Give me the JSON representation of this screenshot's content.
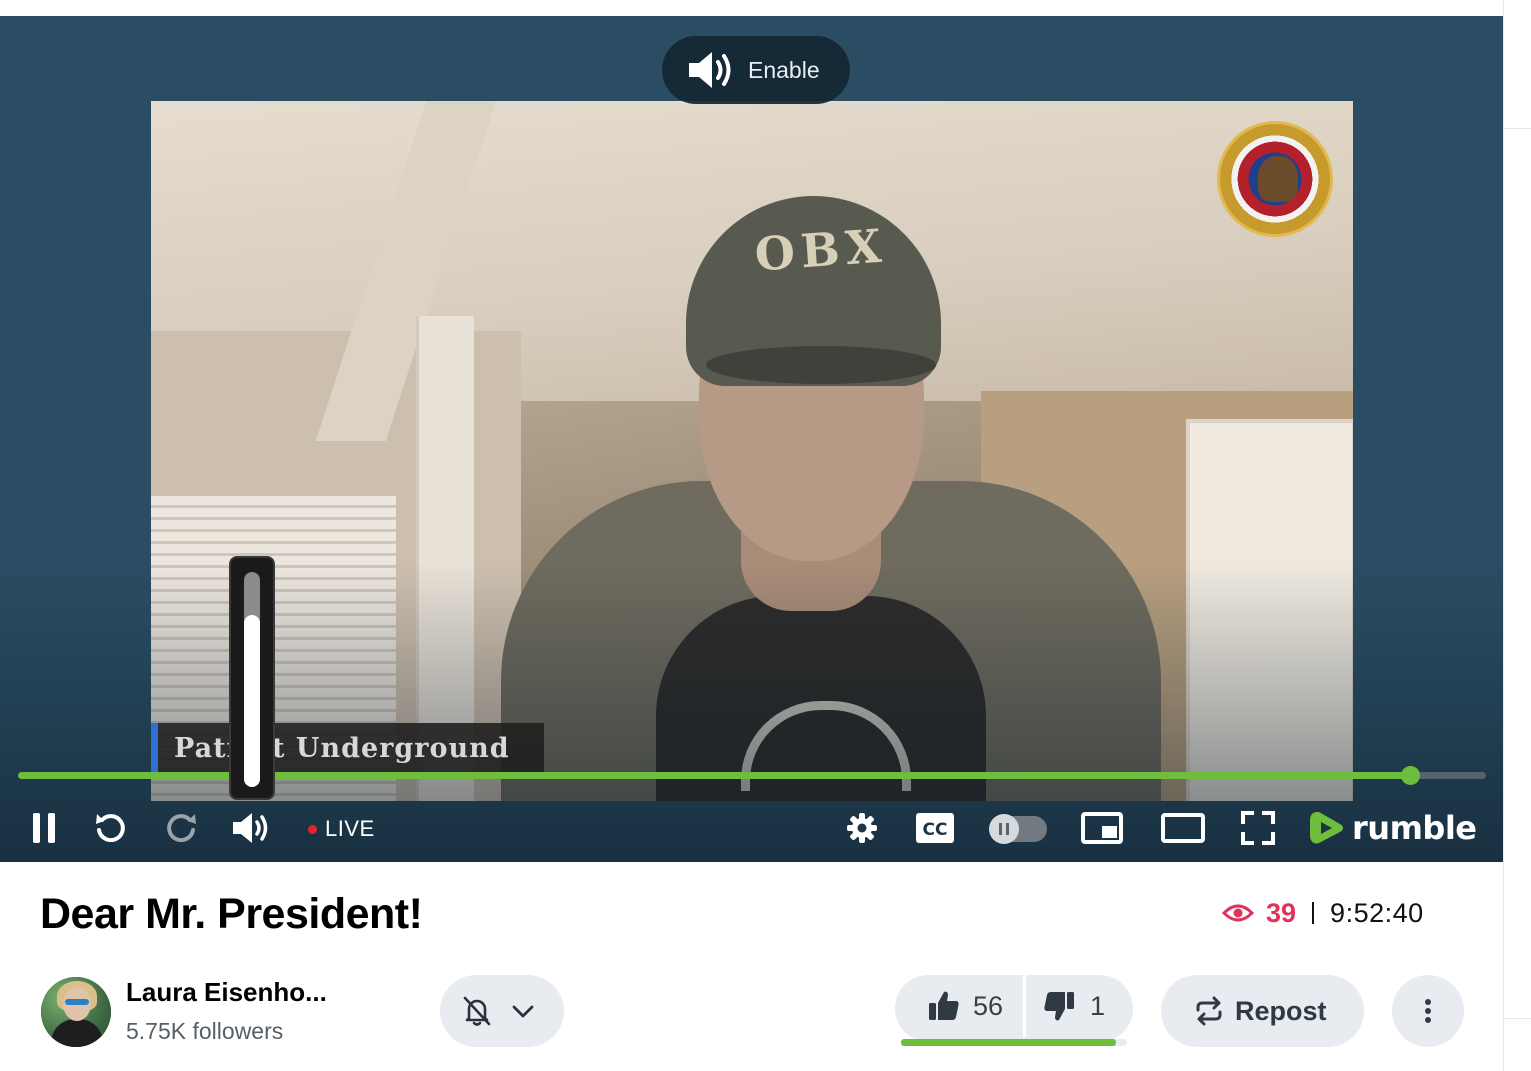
{
  "player": {
    "enable_label": "Enable",
    "overlay_caption": "Patriot Underground",
    "cap_text": "OBX",
    "progress_fraction": 0.948,
    "volume_fraction": 0.8,
    "live_label": "LIVE",
    "brand": "rumble",
    "colors": {
      "accent": "#6ebd3c",
      "live_dot": "#e8212c",
      "player_bg": "#2a4d63"
    },
    "controls": [
      "pause-icon",
      "rewind-icon",
      "forward-icon",
      "volume-icon",
      "settings-icon",
      "cc-icon",
      "autoplay-toggle",
      "pip-icon",
      "theater-icon",
      "fullscreen-icon"
    ]
  },
  "video": {
    "title": "Dear Mr. President!",
    "views": "39",
    "duration": "9:52:40",
    "views_color": "#e0325a"
  },
  "channel": {
    "name": "Laura Eisenho...",
    "followers": "5.75K followers"
  },
  "actions": {
    "likes": "56",
    "dislikes": "1",
    "like_ratio": 0.95,
    "repost_label": "Repost"
  }
}
